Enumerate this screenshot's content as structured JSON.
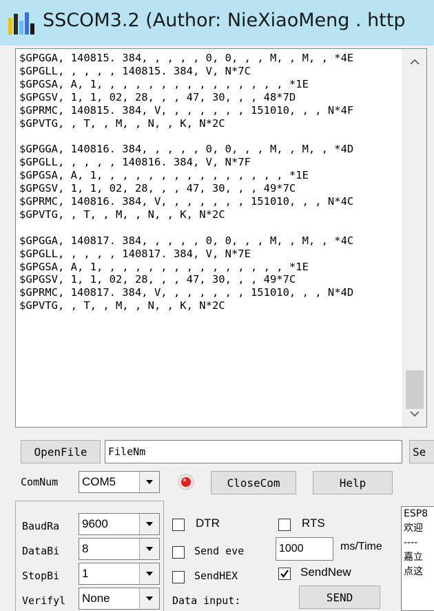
{
  "window": {
    "title": "SSCOM3.2 (Author: NieXiaoMeng . http",
    "icon": "app-bars-icon"
  },
  "terminal": {
    "lines": [
      "$GPGGA, 140815. 384, , , , , 0, 0, , , M, , M, , *4E",
      "$GPGLL, , , , , 140815. 384, V, N*7C",
      "$GPGSA, A, 1, , , , , , , , , , , , , , , *1E",
      "$GPGSV, 1, 1, 02, 28, , , 47, 30, , , 48*7D",
      "$GPRMC, 140815. 384, V, , , , , , , 151010, , , N*4F",
      "$GPVTG, , T, , M, , N, , K, N*2C",
      "",
      "$GPGGA, 140816. 384, , , , , 0, 0, , , M, , M, , *4D",
      "$GPGLL, , , , , 140816. 384, V, N*7F",
      "$GPGSA, A, 1, , , , , , , , , , , , , , , *1E",
      "$GPGSV, 1, 1, 02, 28, , , 47, 30, , , 49*7C",
      "$GPRMC, 140816. 384, V, , , , , , , 151010, , , N*4C",
      "$GPVTG, , T, , M, , N, , K, N*2C",
      "",
      "$GPGGA, 140817. 384, , , , , 0, 0, , , M, , M, , *4C",
      "$GPGLL, , , , , 140817. 384, V, N*7E",
      "$GPGSA, A, 1, , , , , , , , , , , , , , , *1E",
      "$GPGSV, 1, 1, 02, 28, , , 47, 30, , , 49*7C",
      "$GPRMC, 140817. 384, V, , , , , , , 151010, , , N*4D",
      "$GPVTG, , T, , M, , N, , K, N*2C"
    ]
  },
  "file_row": {
    "open_file_label": "OpenFile",
    "filename_value": "FileNm",
    "send_file_label": "Se"
  },
  "com_row": {
    "comnum_label": "ComNum",
    "comnum_value": "COM5",
    "status_color": "#e02020",
    "close_com_label": "CloseCom",
    "help_label": "Help"
  },
  "settings": {
    "baud_label": "BaudRa",
    "baud_value": "9600",
    "databits_label": "DataBi",
    "databits_value": "8",
    "stopbits_label": "StopBi",
    "stopbits_value": "1",
    "verify_label": "Verifyl",
    "verify_value": "None"
  },
  "options": {
    "dtr_label": "DTR",
    "dtr_checked": false,
    "rts_label": "RTS",
    "rts_checked": false,
    "send_every_label": "Send eve",
    "send_every_checked": false,
    "interval_value": "1000",
    "interval_unit": "ms/Time",
    "send_hex_label": "SendHEX",
    "send_hex_checked": false,
    "send_new_label": "SendNew",
    "send_new_checked": true,
    "data_input_label": "Data input:",
    "send_label": "SEND"
  },
  "side_panel": {
    "lines": [
      "ESP8",
      "欢迎",
      "----",
      "嘉立",
      "点这"
    ]
  }
}
